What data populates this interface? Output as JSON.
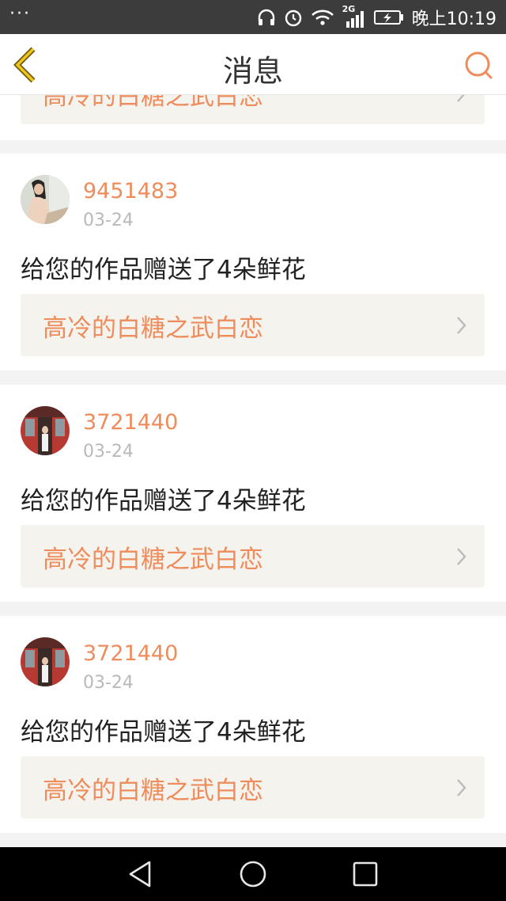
{
  "status_bar": {
    "more": "···",
    "network": "2G",
    "time": "晚上10:19",
    "icons": [
      "headphones-icon",
      "alarm-icon",
      "wifi-icon",
      "signal-icon",
      "battery-charging-icon"
    ]
  },
  "header": {
    "title": "消息",
    "back_icon": "back-chevron-icon",
    "search_icon": "search-icon"
  },
  "accent_color": "#ee8c5c",
  "partial_item": {
    "work_title": "高冷的白糖之武白恋"
  },
  "messages": [
    {
      "username": "9451483",
      "date": "03-24",
      "text": "给您的作品赠送了4朵鲜花",
      "work_title": "高冷的白糖之武白恋",
      "avatar": "avatar-photo"
    },
    {
      "username": "3721440",
      "date": "03-24",
      "text": "给您的作品赠送了4朵鲜花",
      "work_title": "高冷的白糖之武白恋",
      "avatar": "avatar-photo"
    },
    {
      "username": "3721440",
      "date": "03-24",
      "text": "给您的作品赠送了4朵鲜花",
      "work_title": "高冷的白糖之武白恋",
      "avatar": "avatar-photo"
    }
  ],
  "nav_bar": {
    "icons": [
      "nav-back-icon",
      "nav-home-icon",
      "nav-recents-icon"
    ]
  }
}
